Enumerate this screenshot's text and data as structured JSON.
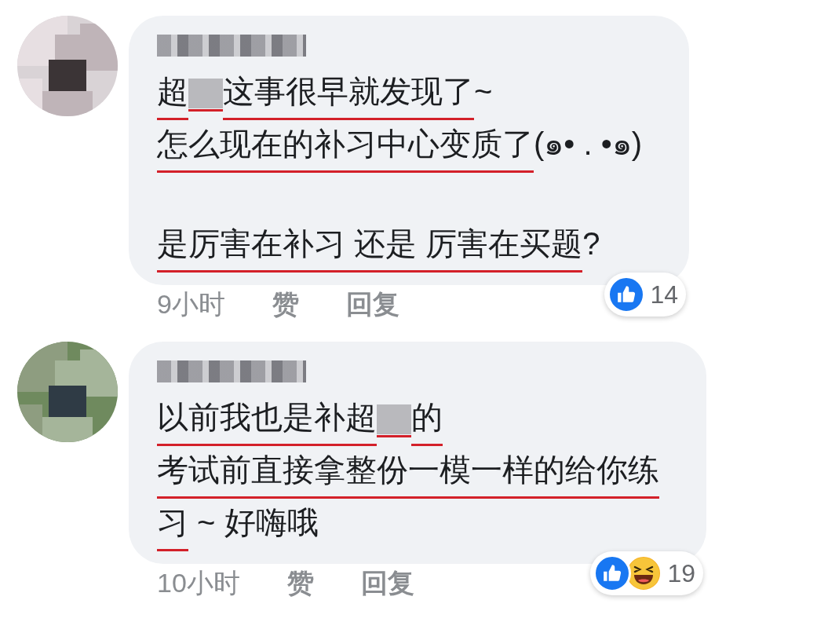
{
  "comments": [
    {
      "author": {
        "redacted": true
      },
      "lines": [
        {
          "kind": "text",
          "segments": [
            {
              "kind": "text",
              "text": "超",
              "underlined": true
            },
            {
              "kind": "redacted",
              "underlined": true
            },
            {
              "kind": "text",
              "text": "这事很早就发现了",
              "underlined": true
            },
            {
              "kind": "text",
              "text": "~",
              "underlined": false
            }
          ]
        },
        {
          "kind": "text",
          "segments": [
            {
              "kind": "text",
              "text": "怎么现在的补习中心变质了",
              "underlined": true
            },
            {
              "kind": "text",
              "text": "(๑• . •๑)",
              "underlined": false
            }
          ]
        },
        {
          "kind": "blank"
        },
        {
          "kind": "text",
          "segments": [
            {
              "kind": "text",
              "text": "是厉害在补习 还是 厉害在买题",
              "underlined": true
            },
            {
              "kind": "text",
              "text": "?",
              "underlined": false
            }
          ]
        }
      ],
      "time": "9小时",
      "like": "赞",
      "reply": "回复",
      "reactions": [
        {
          "kind": "like"
        }
      ],
      "reaction_count": "14"
    },
    {
      "author": {
        "redacted": true
      },
      "lines": [
        {
          "kind": "text",
          "segments": [
            {
              "kind": "text",
              "text": "以前我也是补超",
              "underlined": true
            },
            {
              "kind": "redacted",
              "underlined": true
            },
            {
              "kind": "text",
              "text": "的",
              "underlined": true
            }
          ]
        },
        {
          "kind": "text",
          "segments": [
            {
              "kind": "text",
              "text": "考试前直接拿整份一模一样的给你练",
              "underlined": true
            }
          ]
        },
        {
          "kind": "text",
          "segments": [
            {
              "kind": "text",
              "text": "习",
              "underlined": true
            },
            {
              "kind": "text",
              "text": " ~ 好嗨哦",
              "underlined": false
            }
          ]
        }
      ],
      "time": "10小时",
      "like": "赞",
      "reply": "回复",
      "reactions": [
        {
          "kind": "like"
        },
        {
          "kind": "haha"
        }
      ],
      "reaction_count": "19"
    }
  ]
}
